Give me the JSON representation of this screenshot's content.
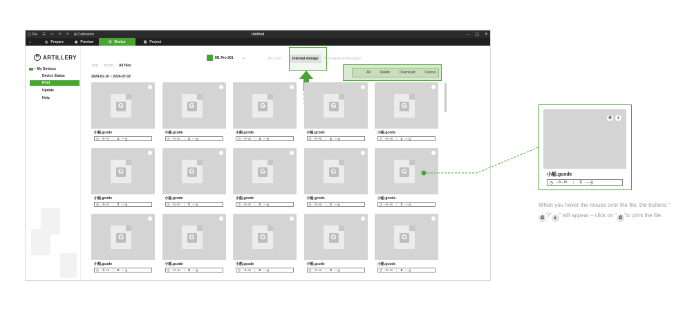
{
  "titlebar": {
    "file": "File",
    "calibration": "Calibration",
    "title": "Untitled",
    "minimize": "–",
    "maximize": "▢",
    "close": "✕"
  },
  "nav": {
    "tabs": [
      {
        "label": "Prepare",
        "active": false
      },
      {
        "label": "Preview",
        "active": false
      },
      {
        "label": "Device",
        "active": true
      },
      {
        "label": "Project",
        "active": false
      }
    ]
  },
  "sidebar": {
    "brand": "ARTILLERY",
    "group": "My Devices",
    "items": [
      {
        "label": "Device Status",
        "active": false
      },
      {
        "label": "Print",
        "active": true
      },
      {
        "label": "Update",
        "active": false
      },
      {
        "label": "Help",
        "active": false
      }
    ]
  },
  "header": {
    "printer": "M1 Pro-001",
    "storage_tabs": [
      {
        "label": "SD Card",
        "active": false
      },
      {
        "label": "Internal storage",
        "active": true
      },
      {
        "label": "Time-lapse photography",
        "active": false
      }
    ],
    "view_tabs": [
      {
        "label": "Year",
        "active": false
      },
      {
        "label": "Month",
        "active": false
      },
      {
        "label": "All files",
        "active": true
      }
    ],
    "date_range": "2024-01-10 ~ 2024-07-02"
  },
  "actions": {
    "all": "All",
    "delete": "Delete",
    "download": "Download",
    "cancel": "Cancel"
  },
  "files": {
    "name": "小船.gcode",
    "time": "--h--m",
    "weight": "----g",
    "icon_letter": "G",
    "count": 15
  },
  "callout": {
    "file_name": "小船.gcode",
    "time": "--h--m",
    "weight": "----g",
    "note_part1": "When you hover the mouse over the file, the buttons “",
    "note_part2": "”/“",
    "note_part3": "” will appear – click on “",
    "note_part4": "”to print the file."
  },
  "colors": {
    "accent": "#49a531",
    "titlebar": "#2c2c2c",
    "card": "#d4d4d4"
  }
}
